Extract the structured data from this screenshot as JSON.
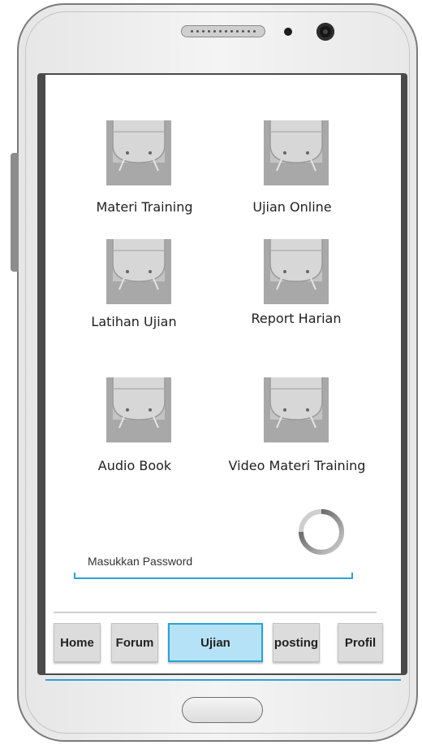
{
  "menu": {
    "items": [
      {
        "label": "Materi Training",
        "icon": "android-placeholder-icon"
      },
      {
        "label": "Ujian Online",
        "icon": "android-placeholder-icon"
      },
      {
        "label": "Latihan Ujian",
        "icon": "android-placeholder-icon"
      },
      {
        "label": "Report Harian",
        "icon": "android-placeholder-icon"
      },
      {
        "label": "Audio Book",
        "icon": "android-placeholder-icon"
      },
      {
        "label": "Video Materi Training",
        "icon": "android-placeholder-icon"
      }
    ]
  },
  "password": {
    "placeholder": "Masukkan Password"
  },
  "tabs": [
    {
      "label": "Home",
      "active": false
    },
    {
      "label": "Forum",
      "active": false
    },
    {
      "label": "Ujian",
      "active": true
    },
    {
      "label": "posting",
      "active": false
    },
    {
      "label": "Profil",
      "active": false
    }
  ],
  "colors": {
    "accent": "#2aa3d6",
    "active_tab_bg": "#b5e2f6",
    "tab_bg": "#dcdcdc",
    "placeholder_tile": "#a8a8a8"
  },
  "icons": {
    "loading": "spinner-icon"
  }
}
